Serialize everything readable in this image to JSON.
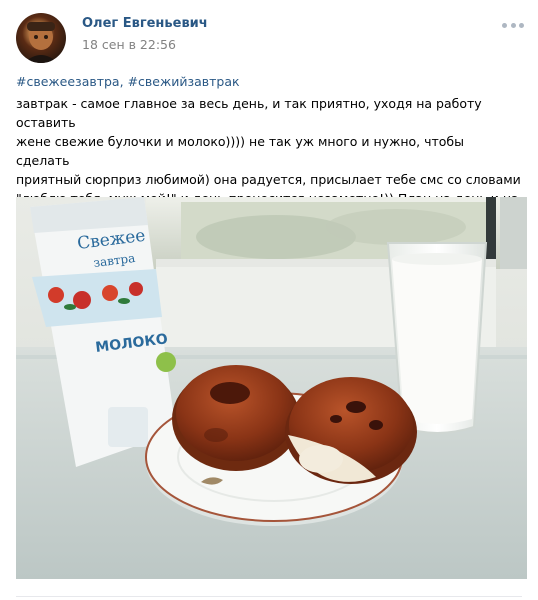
{
  "author": {
    "name": "Олег Евгеньевич"
  },
  "post": {
    "date": "18 сен в 22:56",
    "hashtags": [
      "#свежеезавтра",
      "#свежийзавтрак"
    ],
    "hashtag_separator": ", ",
    "text": "завтрак - самое главное за весь день, и так приятно, уходя на работу оставить\nжене свежие булочки и молоко)))) не так уж много и нужно, чтобы сделать\nприятный сюрприз любимой) она радуется, присылает тебе смс со словами\n\"люблю тебя, муж мой!\" и день проносится незаметно!)) План на день и на всю\nжизнь - моя семья, мое богатство!"
  },
  "photo": {
    "package_brand_line1": "Свежее",
    "package_brand_line2": "завтра",
    "package_product": "МОЛОКО"
  },
  "icons": {
    "more": "more-dots-icon"
  }
}
